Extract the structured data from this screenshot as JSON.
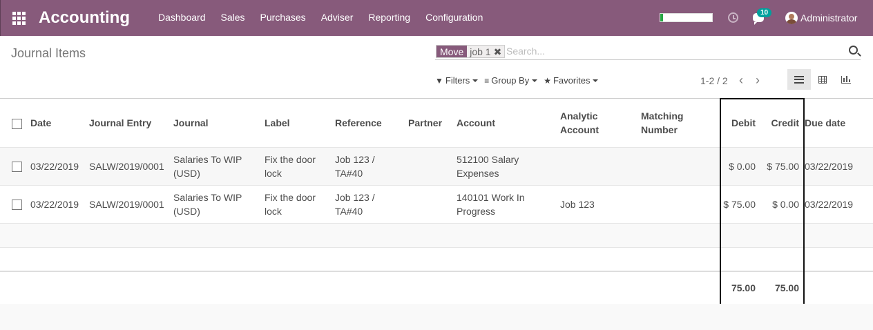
{
  "navbar": {
    "app_title": "Accounting",
    "menu": [
      "Dashboard",
      "Sales",
      "Purchases",
      "Adviser",
      "Reporting",
      "Configuration"
    ],
    "message_count": "10",
    "user_name": "Administrator",
    "progress_fraction": 0.05,
    "brand_color": "#875a7b"
  },
  "control_panel": {
    "title": "Journal Items",
    "search": {
      "facet_label": "Move",
      "facet_value": "job 1",
      "remove_glyph": "✖",
      "placeholder": "Search..."
    },
    "filters_label": "Filters",
    "group_by_label": "Group By",
    "favorites_label": "Favorites",
    "pager": "1-2 / 2",
    "pager_prev": "‹",
    "pager_next": "›"
  },
  "table": {
    "columns": [
      "Date",
      "Journal Entry",
      "Journal",
      "Label",
      "Reference",
      "Partner",
      "Account",
      "Analytic Account",
      "Matching Number",
      "Debit",
      "Credit",
      "Due date"
    ],
    "rows": [
      {
        "date": "03/22/2019",
        "journal_entry": "SALW/2019/0001",
        "journal": "Salaries To WIP (USD)",
        "label": "Fix the door lock",
        "reference": "Job 123 / TA#40",
        "partner": "",
        "account": "512100 Salary Expenses",
        "analytic_account": "",
        "matching_number": "",
        "debit": "$ 0.00",
        "credit": "$ 75.00",
        "due_date": "03/22/2019"
      },
      {
        "date": "03/22/2019",
        "journal_entry": "SALW/2019/0001",
        "journal": "Salaries To WIP (USD)",
        "label": "Fix the door lock",
        "reference": "Job 123 / TA#40",
        "partner": "",
        "account": "140101 Work In Progress",
        "analytic_account": "Job 123",
        "matching_number": "",
        "debit": "$ 75.00",
        "credit": "$ 0.00",
        "due_date": "03/22/2019"
      }
    ],
    "totals": {
      "debit": "75.00",
      "credit": "75.00"
    }
  }
}
